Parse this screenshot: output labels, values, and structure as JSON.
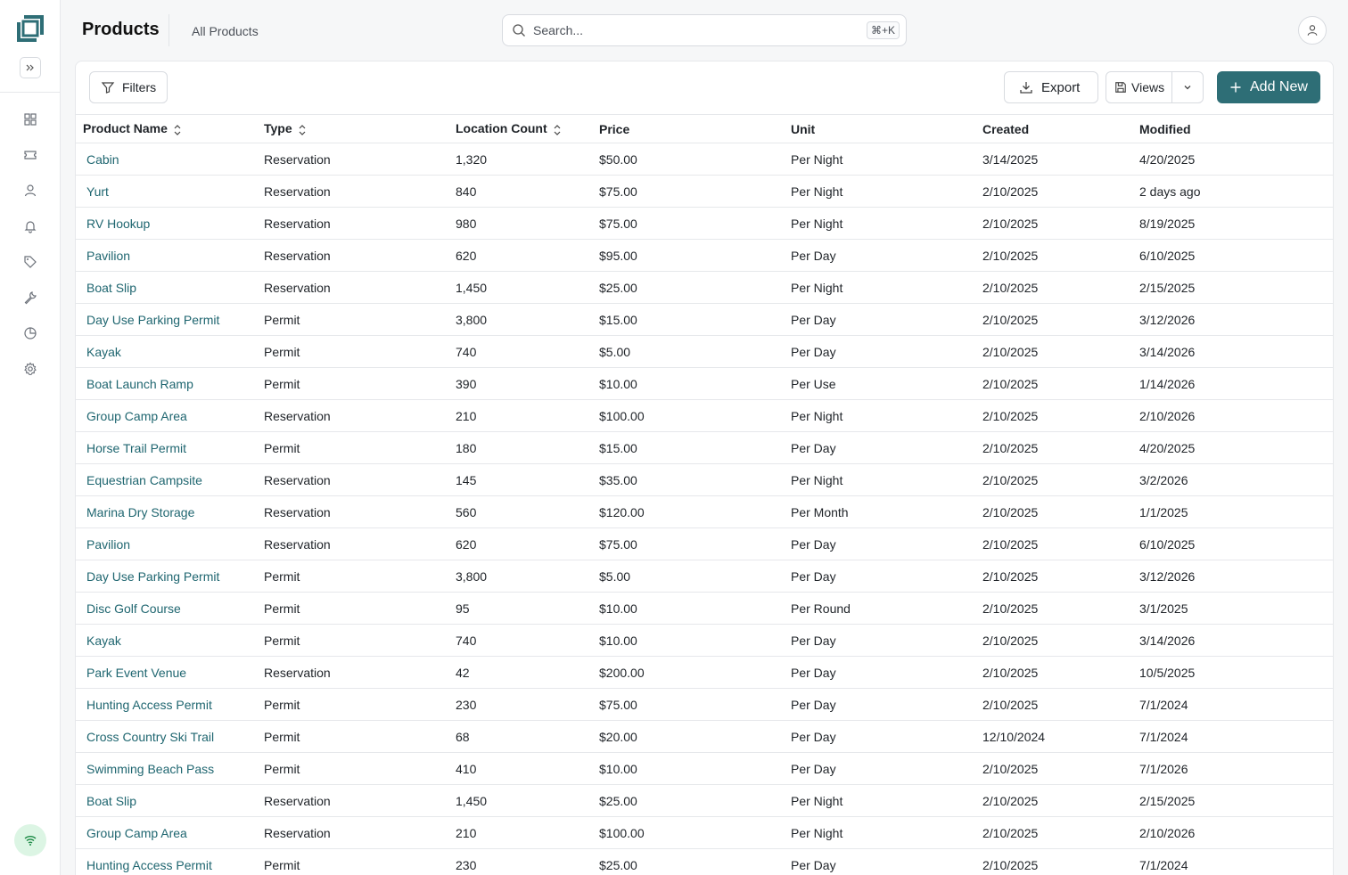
{
  "header": {
    "title": "Products",
    "breadcrumb": "All Products",
    "search_placeholder": "Search...",
    "search_shortcut": "⌘+K"
  },
  "toolbar": {
    "filters_label": "Filters",
    "export_label": "Export",
    "views_label": "Views",
    "add_new_label": "Add New"
  },
  "sidebar": {
    "items": [
      "dashboard-icon",
      "ticket-icon",
      "user-icon",
      "bell-icon",
      "tag-icon",
      "wrench-icon",
      "pie-chart-icon",
      "gear-icon"
    ]
  },
  "colors": {
    "accent": "#2e6e76",
    "link": "#1f6670",
    "status": "#dcf5e4"
  },
  "table": {
    "columns": [
      "Product Name",
      "Type",
      "Location Count",
      "Price",
      "Unit",
      "Created",
      "Modified"
    ],
    "rows": [
      [
        "Cabin",
        "Reservation",
        "1,320",
        "$50.00",
        "Per Night",
        "3/14/2025",
        "4/20/2025"
      ],
      [
        "Yurt",
        "Reservation",
        "840",
        "$75.00",
        "Per Night",
        "2/10/2025",
        "2 days ago"
      ],
      [
        "RV Hookup",
        "Reservation",
        "980",
        "$75.00",
        "Per Night",
        "2/10/2025",
        "8/19/2025"
      ],
      [
        "Pavilion",
        "Reservation",
        "620",
        "$95.00",
        "Per Day",
        "2/10/2025",
        "6/10/2025"
      ],
      [
        "Boat Slip",
        "Reservation",
        "1,450",
        "$25.00",
        "Per Night",
        "2/10/2025",
        "2/15/2025"
      ],
      [
        "Day Use Parking Permit",
        "Permit",
        "3,800",
        "$15.00",
        "Per Day",
        "2/10/2025",
        "3/12/2026"
      ],
      [
        "Kayak",
        "Permit",
        "740",
        "$5.00",
        "Per Day",
        "2/10/2025",
        "3/14/2026"
      ],
      [
        "Boat Launch Ramp",
        "Permit",
        "390",
        "$10.00",
        "Per Use",
        "2/10/2025",
        "1/14/2026"
      ],
      [
        "Group Camp Area",
        "Reservation",
        "210",
        "$100.00",
        "Per Night",
        "2/10/2025",
        "2/10/2026"
      ],
      [
        "Horse Trail Permit",
        "Permit",
        "180",
        "$15.00",
        "Per Day",
        "2/10/2025",
        "4/20/2025"
      ],
      [
        "Equestrian Campsite",
        "Reservation",
        "145",
        "$35.00",
        "Per Night",
        "2/10/2025",
        "3/2/2026"
      ],
      [
        "Marina Dry Storage",
        "Reservation",
        "560",
        "$120.00",
        "Per Month",
        "2/10/2025",
        "1/1/2025"
      ],
      [
        "Pavilion",
        "Reservation",
        "620",
        "$75.00",
        "Per Day",
        "2/10/2025",
        "6/10/2025"
      ],
      [
        "Day Use Parking Permit",
        "Permit",
        "3,800",
        "$5.00",
        "Per Day",
        "2/10/2025",
        "3/12/2026"
      ],
      [
        "Disc Golf Course",
        "Permit",
        "95",
        "$10.00",
        "Per Round",
        "2/10/2025",
        "3/1/2025"
      ],
      [
        "Kayak",
        "Permit",
        "740",
        "$10.00",
        "Per Day",
        "2/10/2025",
        "3/14/2026"
      ],
      [
        "Park Event Venue",
        "Reservation",
        "42",
        "$200.00",
        "Per Day",
        "2/10/2025",
        "10/5/2025"
      ],
      [
        "Hunting Access Permit",
        "Permit",
        "230",
        "$75.00",
        "Per Day",
        "2/10/2025",
        "7/1/2024"
      ],
      [
        "Cross Country Ski Trail",
        "Permit",
        "68",
        "$20.00",
        "Per Day",
        "12/10/2024",
        "7/1/2024"
      ],
      [
        "Swimming Beach Pass",
        "Permit",
        "410",
        "$10.00",
        "Per Day",
        "2/10/2025",
        "7/1/2026"
      ],
      [
        "Boat Slip",
        "Reservation",
        "1,450",
        "$25.00",
        "Per Night",
        "2/10/2025",
        "2/15/2025"
      ],
      [
        "Group Camp Area",
        "Reservation",
        "210",
        "$100.00",
        "Per Night",
        "2/10/2025",
        "2/10/2026"
      ],
      [
        "Hunting Access Permit",
        "Permit",
        "230",
        "$25.00",
        "Per Day",
        "2/10/2025",
        "7/1/2024"
      ]
    ]
  }
}
